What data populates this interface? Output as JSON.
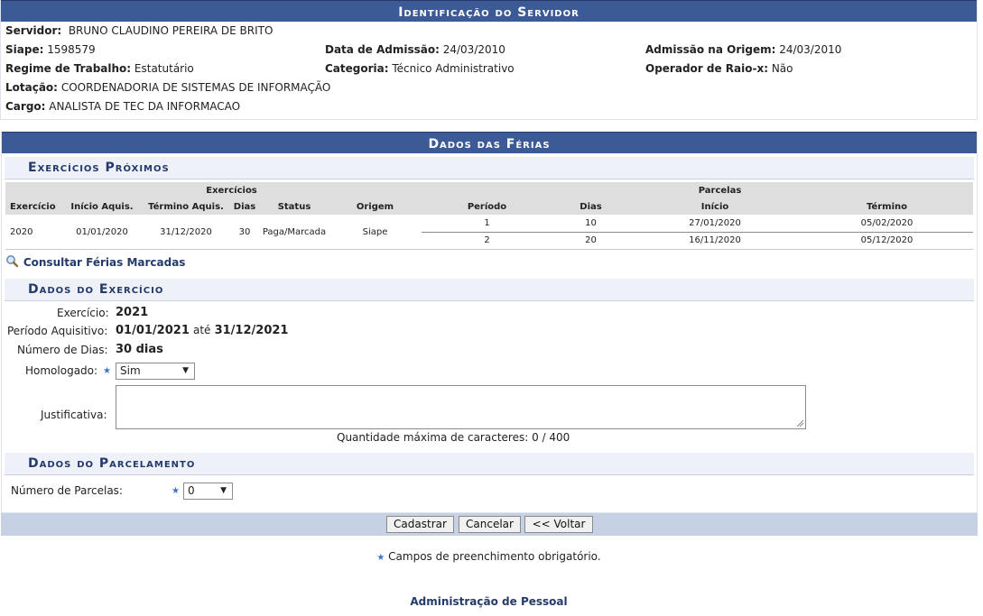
{
  "identificacao": {
    "title": "Identificação do Servidor",
    "servidor_label": "Servidor:",
    "servidor": "BRUNO CLAUDINO PEREIRA DE BRITO",
    "siape_label": "Siape:",
    "siape": "1598579",
    "admissao_label": "Data de Admissão:",
    "admissao": "24/03/2010",
    "admissao_origem_label": "Admissão na Origem:",
    "admissao_origem": "24/03/2010",
    "regime_label": "Regime de Trabalho:",
    "regime": "Estatutário",
    "categoria_label": "Categoria:",
    "categoria": "Técnico Administrativo",
    "raiox_label": "Operador de Raio-x:",
    "raiox": "Não",
    "lotacao_label": "Lotação:",
    "lotacao": "COORDENADORIA DE SISTEMAS DE INFORMAÇÃO",
    "cargo_label": "Cargo:",
    "cargo": "ANALISTA DE TEC DA INFORMACAO"
  },
  "ferias": {
    "title": "Dados das Férias",
    "proximos_title": "Exercícios Próximos",
    "group_exercicios": "Exercícios",
    "group_parcelas": "Parcelas",
    "columns": [
      "Exercício",
      "Início Aquis.",
      "Término Aquis.",
      "Dias",
      "Status",
      "Origem",
      "Período",
      "Dias",
      "Início",
      "Término"
    ],
    "row": {
      "exercicio": "2020",
      "inicio_aquis": "01/01/2020",
      "termino_aquis": "31/12/2020",
      "dias": "30",
      "status": "Paga/Marcada",
      "origem": "Siape"
    },
    "parcelas": [
      {
        "periodo": "1",
        "dias": "10",
        "inicio": "27/01/2020",
        "termino": "05/02/2020"
      },
      {
        "periodo": "2",
        "dias": "20",
        "inicio": "16/11/2020",
        "termino": "05/12/2020"
      }
    ],
    "consultar_link": "Consultar Férias Marcadas"
  },
  "exercicio": {
    "title": "Dados do Exercício",
    "exercicio_label": "Exercício:",
    "exercicio": "2021",
    "periodo_label": "Período Aquisitivo:",
    "periodo_inicio": "01/01/2021",
    "periodo_ate": "até",
    "periodo_fim": "31/12/2021",
    "numero_dias_label": "Número de Dias:",
    "numero_dias": "30 dias",
    "homologado_label": "Homologado:",
    "homologado": "Sim",
    "justificativa_label": "Justificativa:",
    "justificativa": "",
    "contador": "Quantidade máxima de caracteres: 0 / 400"
  },
  "parcelamento": {
    "title": "Dados do Parcelamento",
    "numero_parcelas_label": "Número de Parcelas:",
    "numero_parcelas": "0"
  },
  "buttons": {
    "cadastrar": "Cadastrar",
    "cancelar": "Cancelar",
    "voltar": "<< Voltar"
  },
  "footer": {
    "obrigatorio": "Campos de preenchimento obrigatório.",
    "modulo": "Administração de Pessoal"
  },
  "colors": {
    "caption_bg": "#3c5a96",
    "subtitle": "#233a6b",
    "button_bar": "#c7d1e4"
  },
  "icons": {
    "search": "magnifier-icon",
    "required": "star-icon",
    "dropdown": "triangle-down-icon"
  }
}
